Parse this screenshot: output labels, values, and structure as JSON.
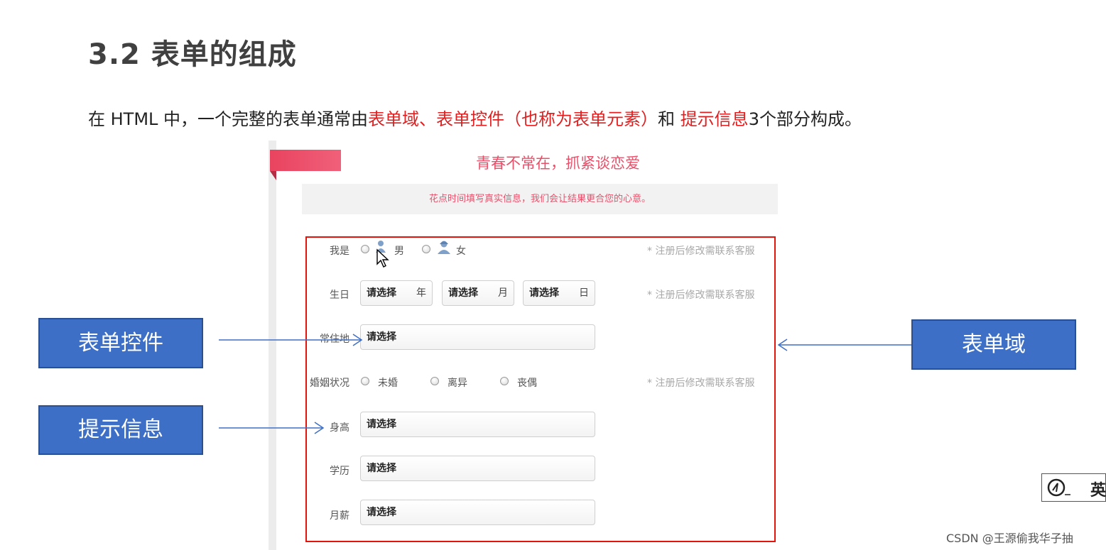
{
  "slide": {
    "title": "3.2 表单的组成",
    "intro": {
      "prefix": "在 HTML 中，一个完整的表单通常由",
      "red1": "表单域、表单控件（也称为表单元素）",
      "mid": "和 ",
      "red2": "提示信息",
      "suffix": "3个部分构成。"
    }
  },
  "form_screenshot": {
    "banner": "青春不常在，抓紧谈恋爱",
    "tip": "花点时间填写真实信息，我们会让结果更合您的心意。",
    "note": "* 注册后修改需联系客服",
    "gender": {
      "label": "我是",
      "male": "男",
      "female": "女",
      "male_icon": "male-user-icon",
      "female_icon": "female-user-icon"
    },
    "birthday": {
      "label": "生日",
      "placeholder": "请选择",
      "year": "年",
      "month": "月",
      "day": "日"
    },
    "residence": {
      "label": "常住地",
      "value": "请选择"
    },
    "marital": {
      "label": "婚姻状况",
      "options": [
        "未婚",
        "离异",
        "丧偶"
      ]
    },
    "height": {
      "label": "身高",
      "value": "请选择"
    },
    "education": {
      "label": "学历",
      "value": "请选择"
    },
    "salary": {
      "label": "月薪",
      "value": "请选择"
    }
  },
  "callouts": {
    "controls": "表单控件",
    "prompt": "提示信息",
    "domain": "表单域"
  },
  "overlay": {
    "ime_label": "英",
    "watermark": "CSDN @王源偷我华子抽"
  },
  "colors": {
    "accent_red": "#e02020",
    "banner_pink": "#e8506a",
    "callout_blue": "#3e6fc6",
    "frame_red": "#e3140b"
  }
}
